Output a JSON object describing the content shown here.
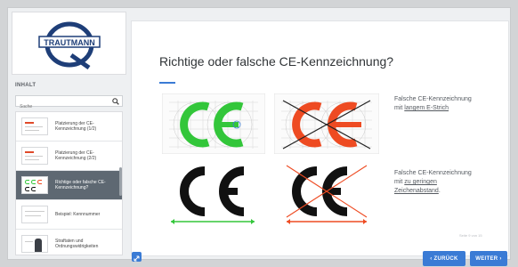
{
  "sidebar": {
    "logo_text": "TRAUTMANN",
    "section_title": "INHALT",
    "search_placeholder": "Suche",
    "items": [
      {
        "label": "Platzierung der CE-Kennzeichnung (1/2)"
      },
      {
        "label": "Platzierung der CE-Kennzeichnung (2/2)"
      },
      {
        "label": "Richtige oder falsche CE-Kennzeichnung?"
      },
      {
        "label": "Beispiel: Kennnummer"
      },
      {
        "label": "Straftaten und Ordnungswidrigkeiten"
      }
    ]
  },
  "main": {
    "title": "Richtige oder falsche CE-Kennzeichnung?",
    "caption1": {
      "line1": "Falsche CE-Kennzeichnung",
      "prefix": "mit ",
      "link": "langem E-Strich"
    },
    "caption2": {
      "line1": "Falsche CE-Kennzeichnung",
      "prefix": "mit ",
      "link1": "zu geringen",
      "link2": "Zeichenabstand",
      "suffix": "."
    },
    "footer_note": "Seite 9 von 15",
    "back_label": "‹ ZURÜCK",
    "next_label": "WEITER ›",
    "ce_text": "CE"
  },
  "colors": {
    "accent": "#3a7bd5",
    "correct": "#33c63a",
    "wrong": "#ee4b22",
    "sidebar_active": "#5e6872"
  }
}
